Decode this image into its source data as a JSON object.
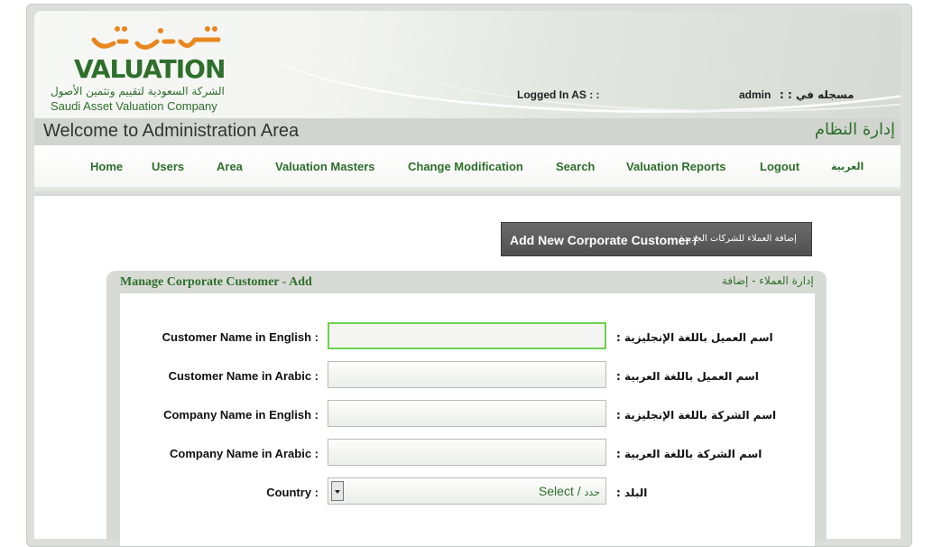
{
  "header": {
    "logo_arabic_wordmark": "ثمين",
    "logo_english_wordmark": "VALUATION",
    "logo_company_arabic": "الشركة السعودية لتقييم وتثمين الأصول",
    "logo_company_english": "Saudi Asset Valuation Company",
    "logged_in_label": "Logged In AS : :",
    "username": "admin",
    "logged_in_arabic": ": : مسجله في",
    "welcome_title": "Welcome to Administration Area",
    "welcome_title_arabic": "إدارة النظام"
  },
  "nav": {
    "items": [
      {
        "label": "Home"
      },
      {
        "label": "Users"
      },
      {
        "label": "Area"
      },
      {
        "label": "Valuation Masters"
      },
      {
        "label": "Change Modification"
      },
      {
        "label": "Search"
      },
      {
        "label": "Valuation Reports"
      },
      {
        "label": "Logout"
      },
      {
        "label": "العربية"
      }
    ]
  },
  "actions": {
    "add_button_english": "Add New Corporate Customer /",
    "add_button_arabic": "إضافة العملاء للشركات الجديدة"
  },
  "panel": {
    "title": "Manage Corporate Customer - Add",
    "title_arabic": "إدارة العملاء - إضافة"
  },
  "form": {
    "fields": [
      {
        "label": "Customer Name in English :",
        "label_arabic": ": اسم العميل باللغة الإنجليزية",
        "value": ""
      },
      {
        "label": "Customer Name in Arabic :",
        "label_arabic": ": اسم العميل باللغة العربية",
        "value": ""
      },
      {
        "label": "Company Name in English :",
        "label_arabic": ": اسم الشركة باللغة الإنجليزية",
        "value": ""
      },
      {
        "label": "Company Name in Arabic :",
        "label_arabic": ": اسم الشركة باللغة العربية",
        "value": ""
      }
    ],
    "country": {
      "label": "Country :",
      "label_arabic": ": البلد",
      "selected": "Select /",
      "selected_arabic": "حدد"
    }
  },
  "colors": {
    "brand_green": "#2d6f2b",
    "brand_orange": "#e8871e",
    "focus_border": "#6bd34f"
  }
}
